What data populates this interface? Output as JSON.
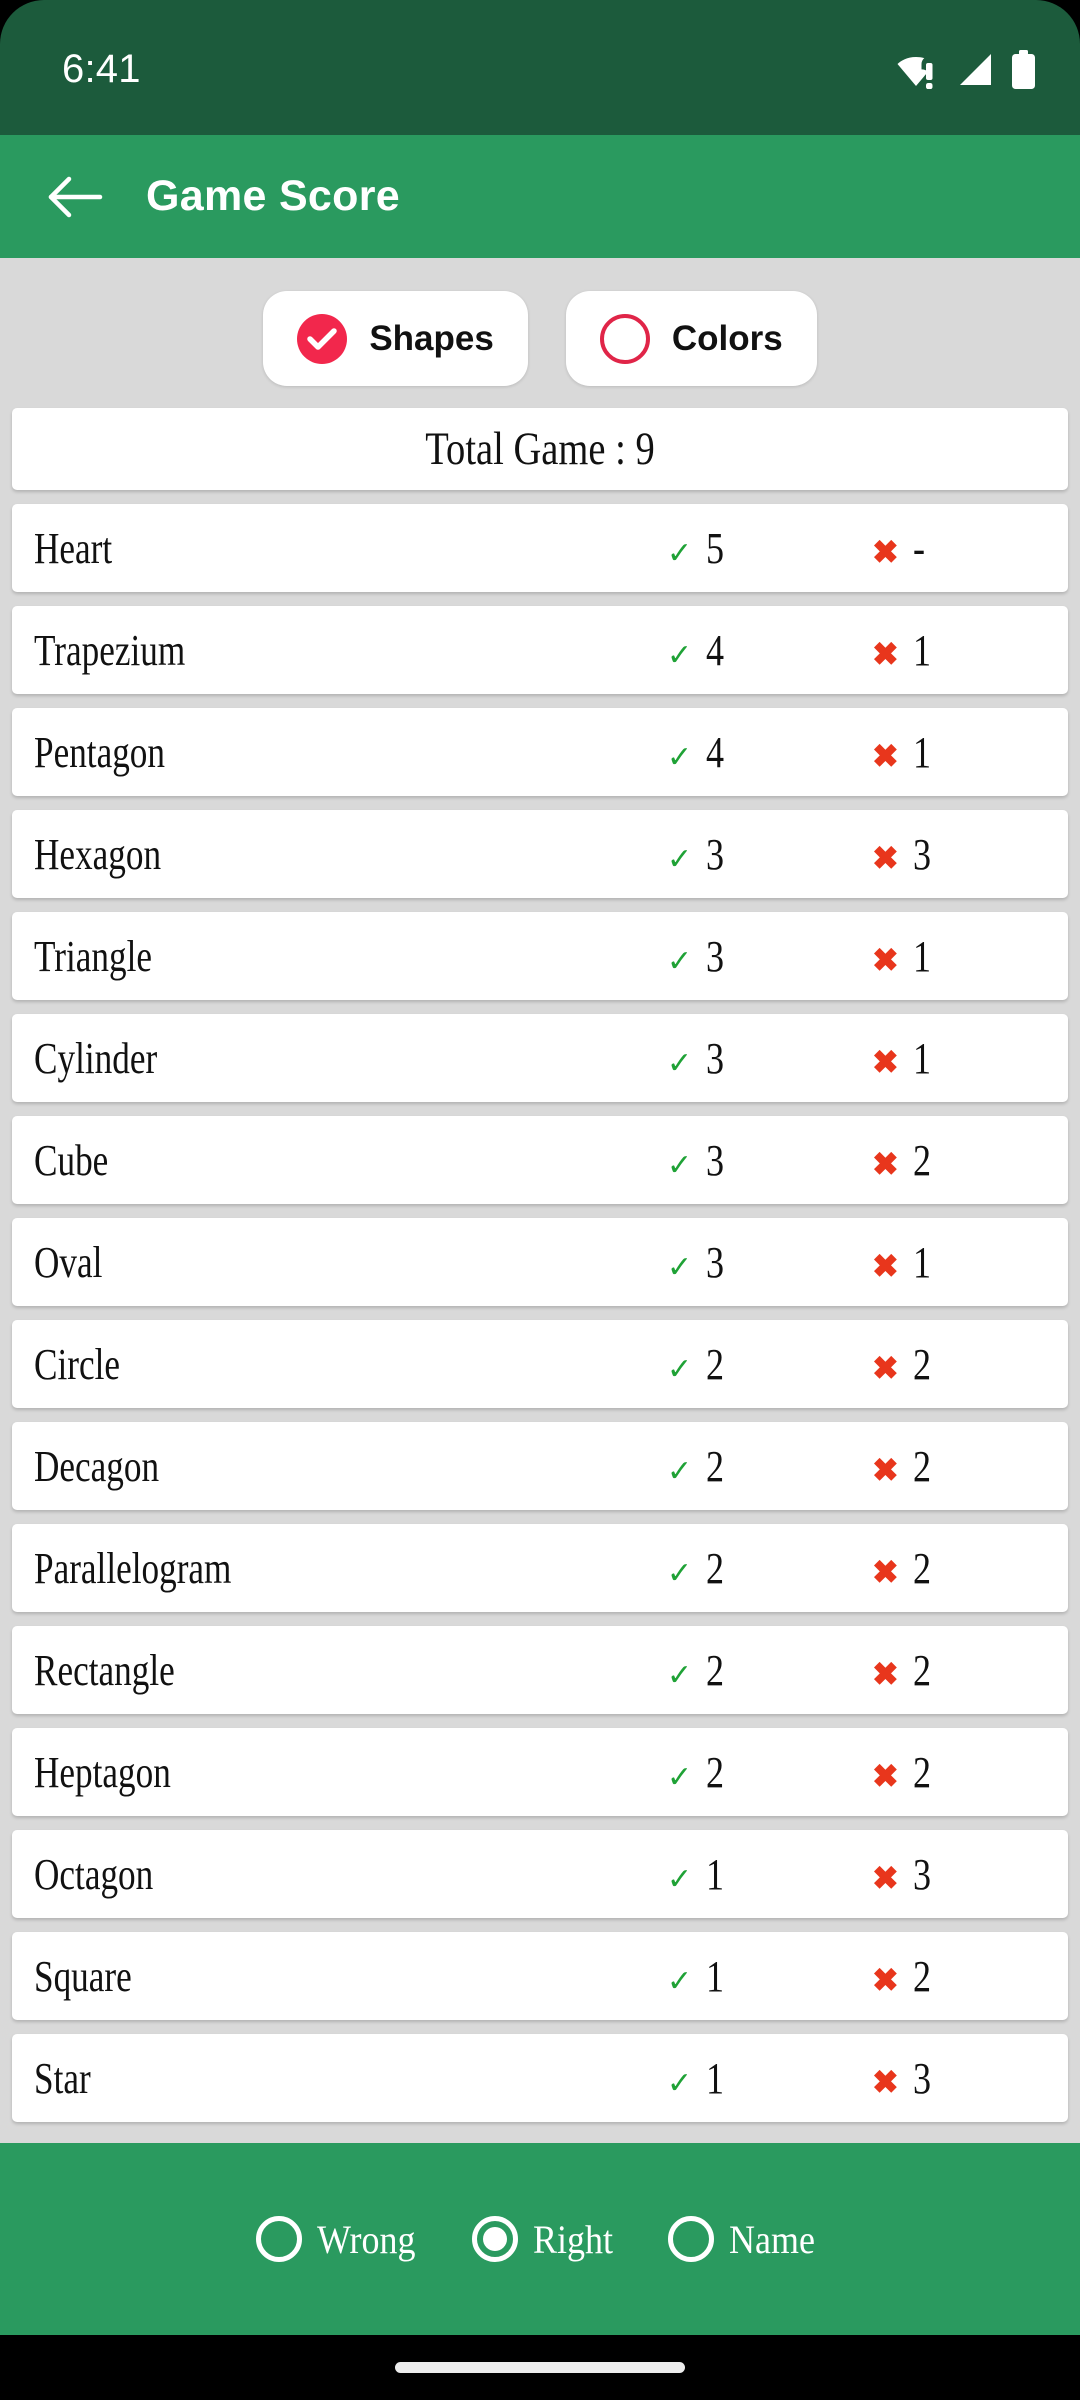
{
  "status_bar": {
    "time": "6:41",
    "icons": [
      "wifi-warning-icon",
      "cellular-signal-icon",
      "battery-full-icon"
    ]
  },
  "app_bar": {
    "back_icon": "arrow-back-icon",
    "title": "Game Score"
  },
  "category_toggle": {
    "options": [
      {
        "label": "Shapes",
        "selected": true
      },
      {
        "label": "Colors",
        "selected": false
      }
    ],
    "selected_color": "#F2274C",
    "unselected_border_color": "#E02548"
  },
  "summary": {
    "total_label": "Total Game : 9"
  },
  "table": {
    "check_icon": "check-mark-icon",
    "cross_icon": "cross-mark-icon",
    "check_color": "#1FA236",
    "cross_color": "#E8361C",
    "rows": [
      {
        "name": "Heart",
        "right": "5",
        "wrong": "-"
      },
      {
        "name": "Trapezium",
        "right": "4",
        "wrong": "1"
      },
      {
        "name": "Pentagon",
        "right": "4",
        "wrong": "1"
      },
      {
        "name": "Hexagon",
        "right": "3",
        "wrong": "3"
      },
      {
        "name": "Triangle",
        "right": "3",
        "wrong": "1"
      },
      {
        "name": "Cylinder",
        "right": "3",
        "wrong": "1"
      },
      {
        "name": "Cube",
        "right": "3",
        "wrong": "2"
      },
      {
        "name": "Oval",
        "right": "3",
        "wrong": "1"
      },
      {
        "name": "Circle",
        "right": "2",
        "wrong": "2"
      },
      {
        "name": "Decagon",
        "right": "2",
        "wrong": "2"
      },
      {
        "name": "Parallelogram",
        "right": "2",
        "wrong": "2"
      },
      {
        "name": "Rectangle",
        "right": "2",
        "wrong": "2"
      },
      {
        "name": "Heptagon",
        "right": "2",
        "wrong": "2"
      },
      {
        "name": "Octagon",
        "right": "1",
        "wrong": "3"
      },
      {
        "name": "Square",
        "right": "1",
        "wrong": "2"
      },
      {
        "name": "Star",
        "right": "1",
        "wrong": "3"
      }
    ]
  },
  "sort_bar": {
    "options": [
      {
        "label": "Wrong",
        "selected": false
      },
      {
        "label": "Right",
        "selected": true
      },
      {
        "label": "Name",
        "selected": false
      }
    ]
  },
  "nav_bar": {
    "handle": "home-gesture-handle"
  },
  "colors": {
    "status_bar": "#1C5B3C",
    "app_bar": "#2A9A5F",
    "page_background": "#D9D9D9",
    "card": "#FFFFFF",
    "bottom_bar": "#2A9A5F"
  }
}
